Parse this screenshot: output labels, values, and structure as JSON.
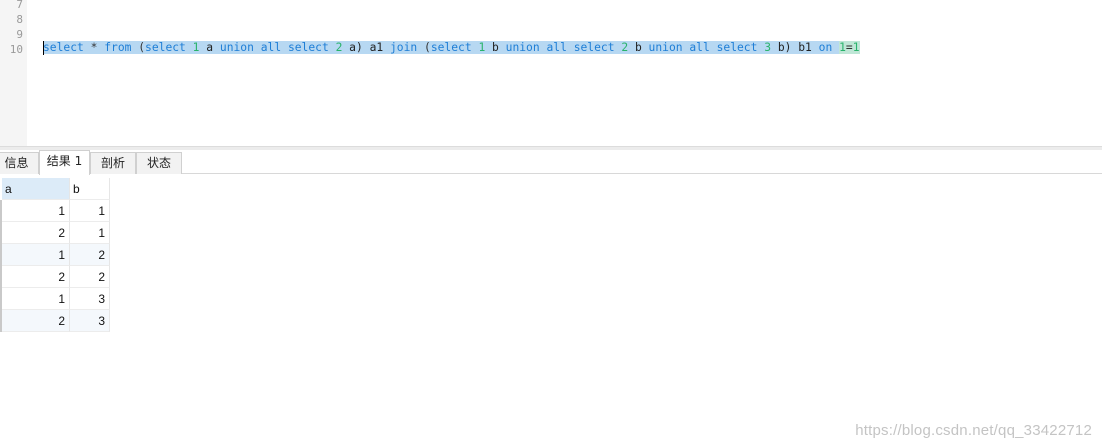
{
  "editor": {
    "line_numbers": [
      "7",
      "8",
      "9",
      "10"
    ],
    "code_tokens": [
      {
        "t": "select",
        "c": "kw"
      },
      {
        "t": " * ",
        "c": "op"
      },
      {
        "t": "from",
        "c": "kw"
      },
      {
        "t": " (",
        "c": "op"
      },
      {
        "t": "select",
        "c": "kw"
      },
      {
        "t": " ",
        "c": "op"
      },
      {
        "t": "1",
        "c": "num"
      },
      {
        "t": " a ",
        "c": "id"
      },
      {
        "t": "union",
        "c": "kw"
      },
      {
        "t": " ",
        "c": "op"
      },
      {
        "t": "all",
        "c": "kw"
      },
      {
        "t": " ",
        "c": "op"
      },
      {
        "t": "select",
        "c": "kw"
      },
      {
        "t": " ",
        "c": "op"
      },
      {
        "t": "2",
        "c": "num"
      },
      {
        "t": " a) a1 ",
        "c": "id"
      },
      {
        "t": "join",
        "c": "kw"
      },
      {
        "t": " (",
        "c": "op"
      },
      {
        "t": "select",
        "c": "kw"
      },
      {
        "t": " ",
        "c": "op"
      },
      {
        "t": "1",
        "c": "num"
      },
      {
        "t": " b ",
        "c": "id"
      },
      {
        "t": "union",
        "c": "kw"
      },
      {
        "t": " ",
        "c": "op"
      },
      {
        "t": "all",
        "c": "kw"
      },
      {
        "t": " ",
        "c": "op"
      },
      {
        "t": "select",
        "c": "kw"
      },
      {
        "t": " ",
        "c": "op"
      },
      {
        "t": "2",
        "c": "num"
      },
      {
        "t": " b ",
        "c": "id"
      },
      {
        "t": "union",
        "c": "kw"
      },
      {
        "t": " ",
        "c": "op"
      },
      {
        "t": "all",
        "c": "kw"
      },
      {
        "t": " ",
        "c": "op"
      },
      {
        "t": "select",
        "c": "kw"
      },
      {
        "t": " ",
        "c": "op"
      },
      {
        "t": "3",
        "c": "num"
      },
      {
        "t": " b) b1 ",
        "c": "id"
      },
      {
        "t": "on",
        "c": "kw"
      },
      {
        "t": " ",
        "c": "op"
      },
      {
        "t": "1",
        "c": "num"
      },
      {
        "t": "=",
        "c": "op"
      },
      {
        "t": "1",
        "c": "num"
      }
    ]
  },
  "tabs": [
    {
      "label": "信息",
      "active": false
    },
    {
      "label": "结果 1",
      "active": true
    },
    {
      "label": "剖析",
      "active": false
    },
    {
      "label": "状态",
      "active": false
    }
  ],
  "result_grid": {
    "columns": [
      "a",
      "b"
    ],
    "rows": [
      [
        "1",
        "1"
      ],
      [
        "2",
        "1"
      ],
      [
        "1",
        "2"
      ],
      [
        "2",
        "2"
      ],
      [
        "1",
        "3"
      ],
      [
        "2",
        "3"
      ]
    ]
  },
  "watermark": "https://blog.csdn.net/qq_33422712"
}
